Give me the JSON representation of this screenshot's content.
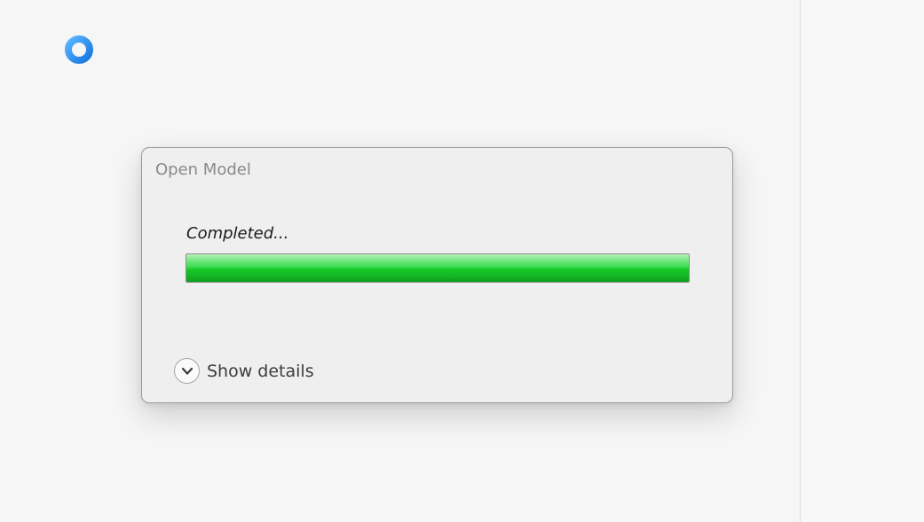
{
  "dialog": {
    "title": "Open Model",
    "status": "Completed...",
    "progress_percent": 100,
    "show_details_label": "Show details"
  },
  "colors": {
    "spinner_accent": "#1e90ff",
    "progress_green": "#14c928"
  },
  "icons": {
    "busy": "spinner-ring-icon",
    "details": "chevron-down-icon"
  }
}
